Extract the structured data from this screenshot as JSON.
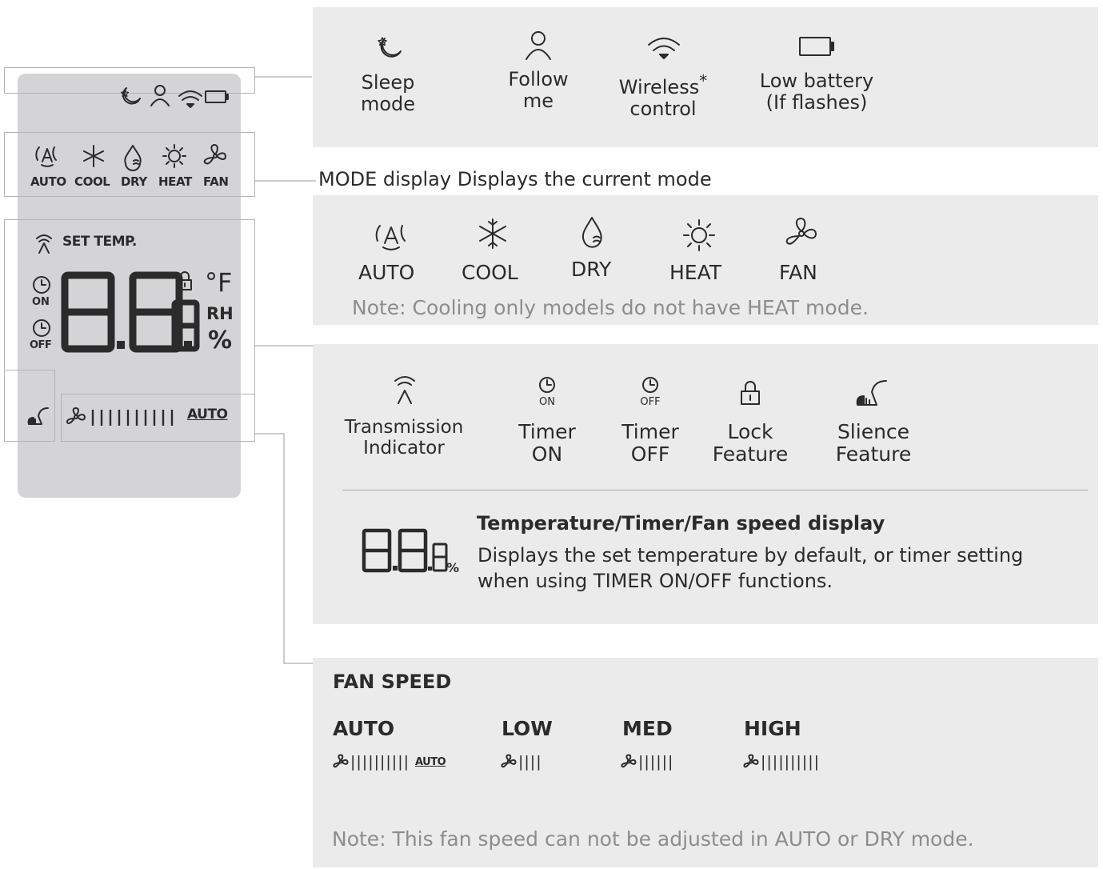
{
  "remote": {
    "set_temp_label": "SET TEMP.",
    "on_label": "ON",
    "off_label": "OFF",
    "unit_f": "°F",
    "rh_label": "RH",
    "percent_label": "%",
    "auto_label": "AUTO",
    "modes": [
      "AUTO",
      "COOL",
      "DRY",
      "HEAT",
      "FAN"
    ]
  },
  "status_panel": {
    "items": [
      {
        "icon": "moon-star-icon",
        "label": [
          "Sleep",
          "mode"
        ]
      },
      {
        "icon": "person-icon",
        "label": [
          "Follow",
          "me"
        ]
      },
      {
        "icon": "wifi-icon",
        "label": [
          "Wireless",
          "control"
        ],
        "suffix": "*"
      },
      {
        "icon": "battery-icon",
        "label": [
          "Low battery",
          "(If flashes)"
        ]
      }
    ]
  },
  "mode_panel": {
    "heading": "MODE display Displays the current mode",
    "items": [
      {
        "icon": "auto-icon",
        "label": "AUTO"
      },
      {
        "icon": "snowflake-icon",
        "label": "COOL"
      },
      {
        "icon": "droplet-icon",
        "label": "DRY"
      },
      {
        "icon": "sun-icon",
        "label": "HEAT"
      },
      {
        "icon": "fan-icon",
        "label": "FAN"
      }
    ],
    "note": "Note: Cooling only models do not have HEAT mode."
  },
  "indicator_panel": {
    "items": [
      {
        "icon": "transmission-icon",
        "label": [
          "Transmission",
          "Indicator"
        ]
      },
      {
        "icon": "timer-on-icon",
        "icon_text": "ON",
        "label": [
          "Timer",
          "ON"
        ]
      },
      {
        "icon": "timer-off-icon",
        "icon_text": "OFF",
        "label": [
          "Timer",
          "OFF"
        ]
      },
      {
        "icon": "lock-icon",
        "label": [
          "Lock",
          "Feature"
        ]
      },
      {
        "icon": "silence-icon",
        "label": [
          "Slience",
          "Feature"
        ]
      }
    ],
    "display_title": "Temperature/Timer/Fan speed display",
    "display_desc": [
      "Displays the set temperature by default, or timer setting",
      "when using TIMER ON/OFF functions."
    ],
    "percent_label": "%"
  },
  "fan_panel": {
    "title": "FAN SPEED",
    "speeds": [
      {
        "label": "AUTO",
        "bars": "||||||||||",
        "suffix": "AUTO"
      },
      {
        "label": "LOW",
        "bars": "||||",
        "suffix": ""
      },
      {
        "label": "MED",
        "bars": "||||||",
        "suffix": ""
      },
      {
        "label": "HIGH",
        "bars": "||||||||||",
        "suffix": ""
      }
    ],
    "note": "Note: This fan speed can not be adjusted in AUTO or DRY mode."
  }
}
